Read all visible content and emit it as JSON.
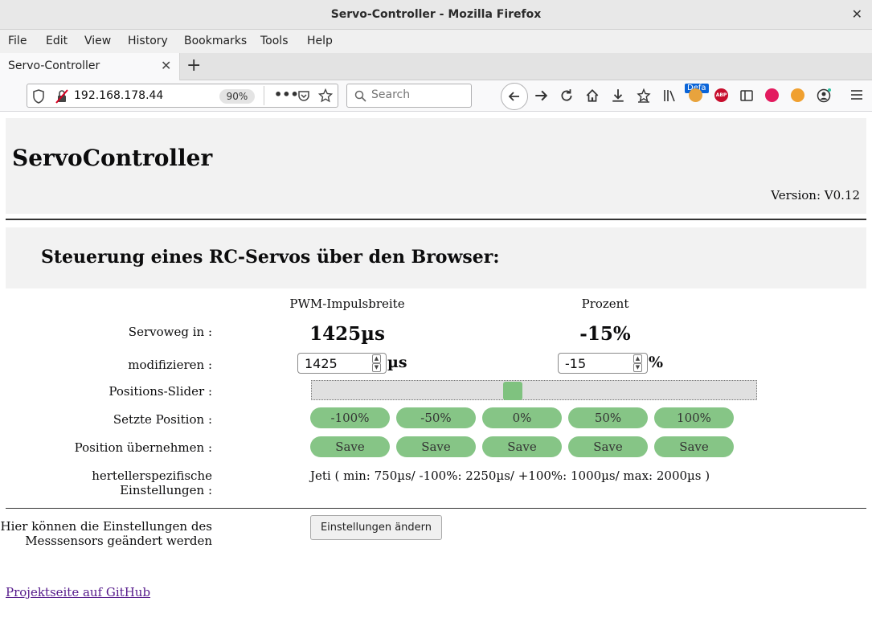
{
  "browser": {
    "window_title": "Servo-Controller - Mozilla Firefox",
    "menu": [
      "File",
      "Edit",
      "View",
      "History",
      "Bookmarks",
      "Tools",
      "Help"
    ],
    "tab_title": "Servo-Controller",
    "url": "192.168.178.44",
    "zoom": "90%",
    "search_placeholder": "Search",
    "badge": "Defa"
  },
  "header": {
    "title": "ServoController",
    "version": "Version: V0.12"
  },
  "section": {
    "heading": "Steuerung eines RC-Servos über den Browser:"
  },
  "columns": {
    "pwm": "PWM-Impulsbreite",
    "percent": "Prozent"
  },
  "labels": {
    "servoweg": "Servoweg in :",
    "modifizieren": "modifizieren :",
    "slider": "Positions-Slider :",
    "setzte": "Setzte Position :",
    "uebernehmen": "Position übernehmen :",
    "hersteller_line1": "hertellerspezifische",
    "hersteller_line2": "Einstellungen :",
    "sensor_line1": "Hier können die Einstellungen des",
    "sensor_line2": "Messsensors geändert werden"
  },
  "values": {
    "pwm_display": "1425µs",
    "percent_display": "-15%",
    "pwm_input": "1425",
    "pwm_unit": "µs",
    "percent_input": "-15",
    "percent_unit": "%",
    "slider_fraction": 0.45
  },
  "position_buttons": [
    "-100%",
    "-50%",
    "0%",
    "50%",
    "100%"
  ],
  "save_buttons": [
    "Save",
    "Save",
    "Save",
    "Save",
    "Save"
  ],
  "hersteller_text": "Jeti ( min: 750µs/ -100%: 2250µs/ +100%: 1000µs/ max: 2000µs )",
  "settings_button": "Einstellungen ändern",
  "github_link": "Projektseite auf GitHub",
  "colors": {
    "button_green": "#86c586",
    "slider_thumb": "#7fc27f",
    "panel_bg": "#f2f2f2",
    "link": "#551a8b"
  }
}
